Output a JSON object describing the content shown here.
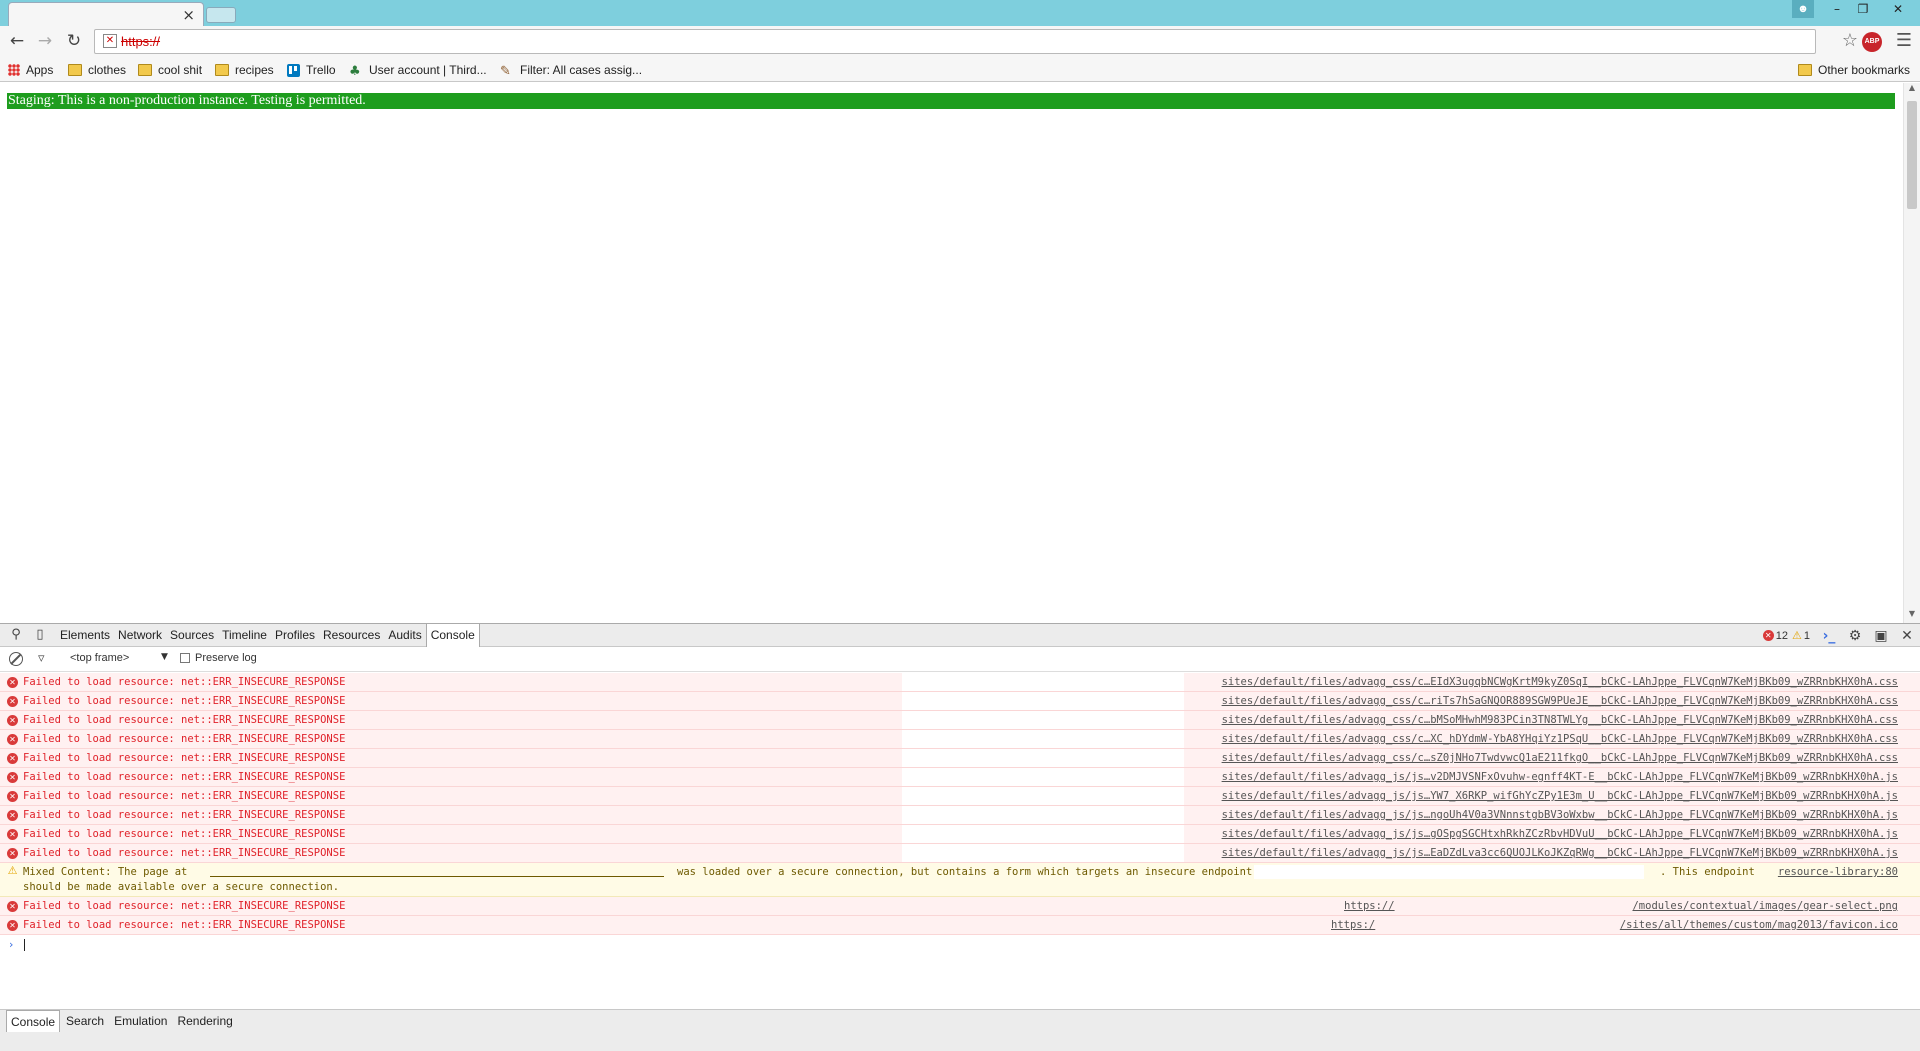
{
  "browser": {
    "tab": {
      "close": "×"
    },
    "url": {
      "scheme": "https://",
      "rest": ""
    },
    "window_controls": {
      "minimize": "–",
      "restore": "❐",
      "close": "✕"
    }
  },
  "bookmarks": {
    "items": [
      "Apps",
      "clothes",
      "cool shit",
      "recipes",
      "Trello",
      "User account | Third...",
      "Filter: All cases assig..."
    ],
    "other": "Other bookmarks"
  },
  "page": {
    "banner": "Staging: This is a non-production instance. Testing is permitted."
  },
  "devtools": {
    "tabs": [
      "Elements",
      "Network",
      "Sources",
      "Timeline",
      "Profiles",
      "Resources",
      "Audits",
      "Console"
    ],
    "active_tab": "Console",
    "error_count": "12",
    "warning_count": "1",
    "frame": "<top frame>",
    "preserve_log": "Preserve log",
    "error_msg": "Failed to load resource: net::ERR_INSECURE_RESPONSE",
    "rows": [
      "sites/default/files/advagg_css/c…EIdX3ugqbNCWgKrtM9kyZ0SqI__bCkC-LAhJppe_FLVCqnW7KeMjBKb09_wZRRnbKHX0hA.css",
      "sites/default/files/advagg_css/c…riTs7hSaGNQOR889SGW9PUeJE__bCkC-LAhJppe_FLVCqnW7KeMjBKb09_wZRRnbKHX0hA.css",
      "sites/default/files/advagg_css/c…bMSoMHwhM983PCin3TN8TWLYg__bCkC-LAhJppe_FLVCqnW7KeMjBKb09_wZRRnbKHX0hA.css",
      "sites/default/files/advagg_css/c…XC_hDYdmW-YbA8YHqiYz1PSqU__bCkC-LAhJppe_FLVCqnW7KeMjBKb09_wZRRnbKHX0hA.css",
      "sites/default/files/advagg_css/c…sZ0jNHo7TwdvwcQ1aE211fkgO__bCkC-LAhJppe_FLVCqnW7KeMjBKb09_wZRRnbKHX0hA.css",
      "sites/default/files/advagg_js/js…v2DMJVSNFxOvuhw-egnff4KT-E__bCkC-LAhJppe_FLVCqnW7KeMjBKb09_wZRRnbKHX0hA.js",
      "sites/default/files/advagg_js/js…YW7_X6RKP_wifGhYcZPy1E3m_U__bCkC-LAhJppe_FLVCqnW7KeMjBKb09_wZRRnbKHX0hA.js",
      "sites/default/files/advagg_js/js…ngoUh4V0a3VNnnstgbBV3oWxbw__bCkC-LAhJppe_FLVCqnW7KeMjBKb09_wZRRnbKHX0hA.js",
      "sites/default/files/advagg_js/js…gOSpgSGCHtxhRkhZCzRbvHDVuU__bCkC-LAhJppe_FLVCqnW7KeMjBKb09_wZRRnbKHX0hA.js",
      "sites/default/files/advagg_js/js…EaDZdLva3cc6QUOJLKoJKZqRWg__bCkC-LAhJppe_FLVCqnW7KeMjBKb09_wZRRnbKHX0hA.js"
    ],
    "warning": {
      "part1": "Mixed Content: The page at",
      "part2": "was loaded over a secure connection, but contains a form which targets an insecure endpoint",
      "part3": ". This endpoint",
      "line2": "should be made available over a secure connection.",
      "source": "resource-library:80"
    },
    "extra_rows": [
      {
        "prefix": "https://",
        "path": "/modules/contextual/images/gear-select.png"
      },
      {
        "prefix": "https:/",
        "path": "/sites/all/themes/custom/mag2013/favicon.ico"
      }
    ],
    "drawer_tabs": [
      "Console",
      "Search",
      "Emulation",
      "Rendering"
    ]
  }
}
